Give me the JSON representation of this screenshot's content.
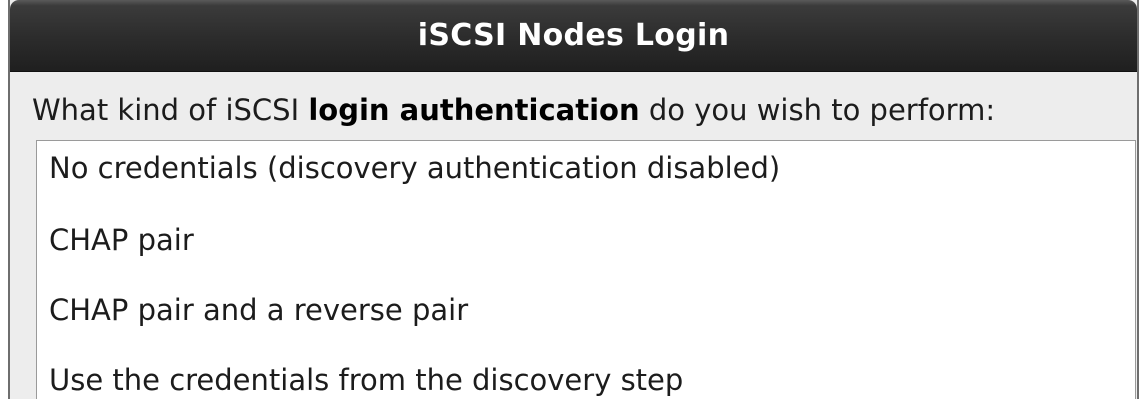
{
  "dialog": {
    "title": "iSCSI Nodes Login",
    "prompt_before": "What kind of iSCSI ",
    "prompt_bold": "login authentication",
    "prompt_after": " do you wish to perform:",
    "options": [
      "No credentials (discovery authentication disabled)",
      "CHAP pair",
      "CHAP pair and a reverse pair",
      "Use the credentials from the discovery step"
    ]
  }
}
